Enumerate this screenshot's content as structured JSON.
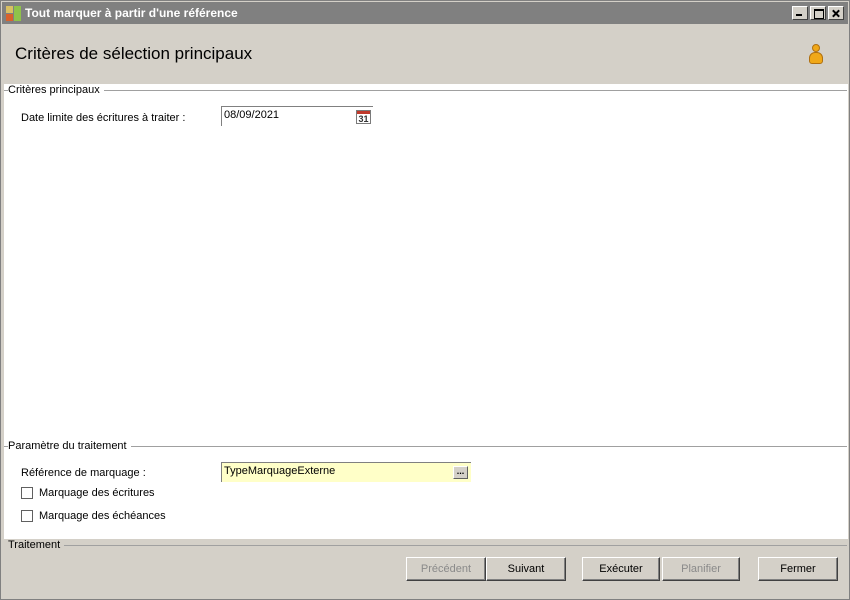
{
  "window": {
    "title": "Tout marquer à partir d'une référence"
  },
  "header": {
    "title": "Critères de sélection principaux"
  },
  "criteria": {
    "section_title": "Critères principaux",
    "date_label": "Date limite des écritures à traiter :",
    "date_value": "08/09/2021",
    "calendar_day": "31"
  },
  "params": {
    "section_title": "Paramètre du traitement",
    "reference_label": "Référence de marquage :",
    "reference_value": "TypeMarquageExterne",
    "reference_button": "...",
    "checkbox_entries_label": "Marquage des écritures",
    "checkbox_entries_checked": false,
    "checkbox_due_label": "Marquage des échéances",
    "checkbox_due_checked": false
  },
  "footer": {
    "section_title": "Traitement",
    "buttons": {
      "previous": "Précédent",
      "next": "Suivant",
      "execute": "Exécuter",
      "schedule": "Planifier",
      "close": "Fermer"
    }
  },
  "colors": {
    "titlebar": "#808080",
    "reference_field_bg": "#ffffc8",
    "window_bg": "#d4d0c8"
  }
}
